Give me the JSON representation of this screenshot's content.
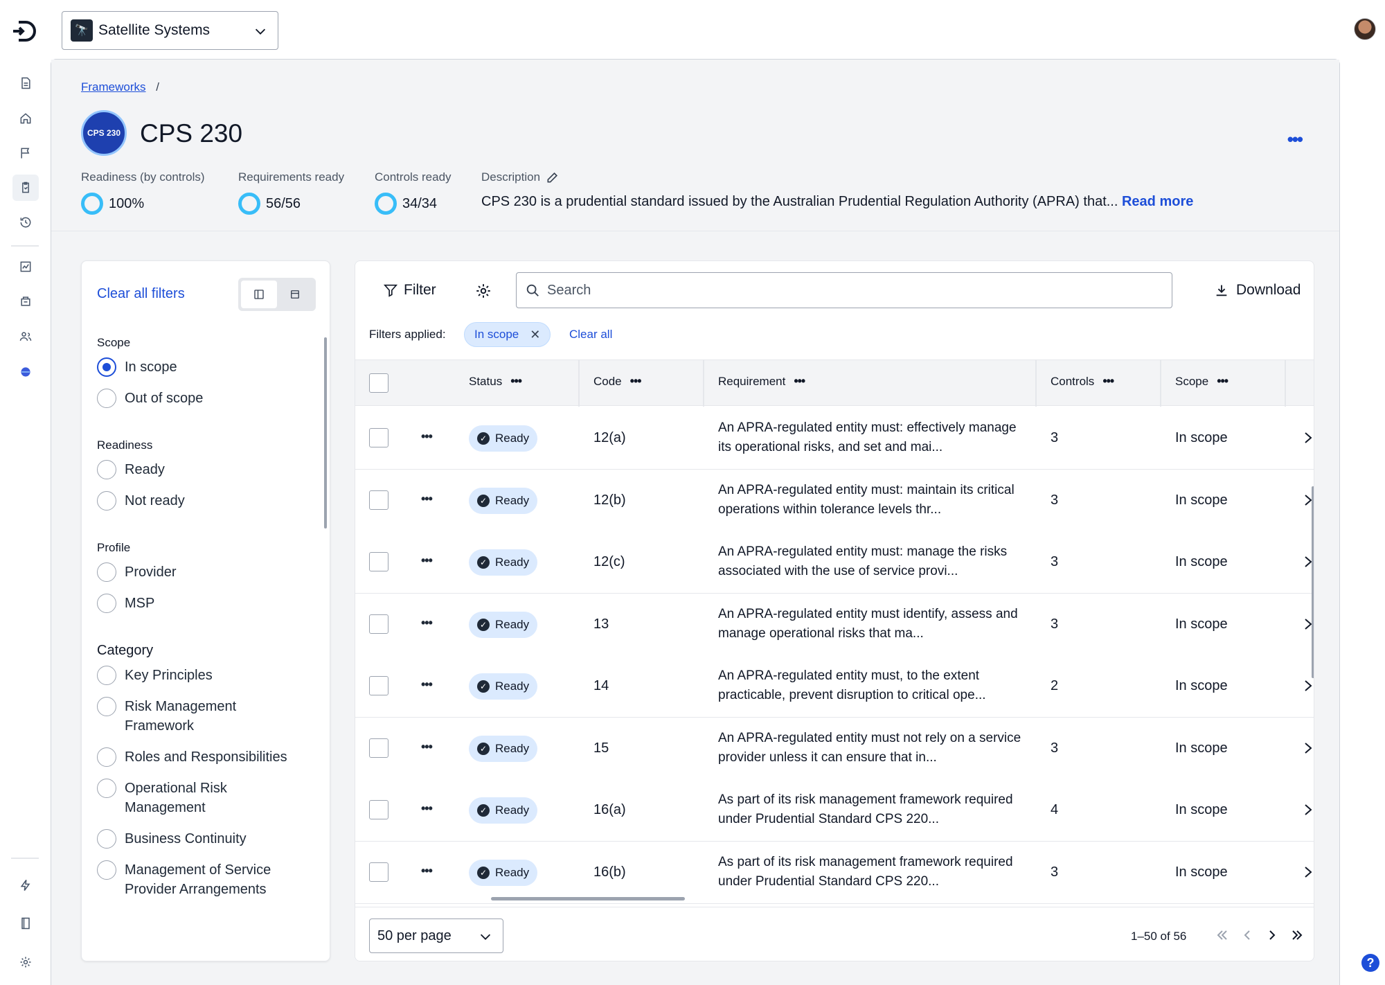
{
  "workspace": {
    "name": "Satellite Systems",
    "icon": "telescope-icon"
  },
  "breadcrumb": {
    "parent": "Frameworks",
    "separator": "/"
  },
  "framework": {
    "logo_text": "CPS 230",
    "title": "CPS 230",
    "stats": {
      "readiness_label": "Readiness (by controls)",
      "readiness_value": "100%",
      "requirements_label": "Requirements ready",
      "requirements_value": "56/56",
      "controls_label": "Controls ready",
      "controls_value": "34/34"
    },
    "description_label": "Description",
    "description": "CPS 230 is a prudential standard issued by the Australian Prudential Regulation Authority (APRA) that...",
    "read_more": "Read more"
  },
  "filters": {
    "clear_all": "Clear all filters",
    "groups": [
      {
        "title": "Scope",
        "options": [
          {
            "label": "In scope",
            "selected": true
          },
          {
            "label": "Out of scope",
            "selected": false
          }
        ]
      },
      {
        "title": "Readiness",
        "options": [
          {
            "label": "Ready",
            "selected": false
          },
          {
            "label": "Not ready",
            "selected": false
          }
        ]
      },
      {
        "title": "Profile",
        "options": [
          {
            "label": "Provider",
            "selected": false
          },
          {
            "label": "MSP",
            "selected": false
          }
        ]
      },
      {
        "title": "Category",
        "options": [
          {
            "label": "Key Principles",
            "selected": false
          },
          {
            "label": "Risk Management Framework",
            "selected": false
          },
          {
            "label": "Roles and Responsibilities",
            "selected": false
          },
          {
            "label": "Operational Risk Management",
            "selected": false
          },
          {
            "label": "Business Continuity",
            "selected": false
          },
          {
            "label": "Management of Service Provider Arrangements",
            "selected": false
          }
        ]
      }
    ]
  },
  "toolbar": {
    "filter_label": "Filter",
    "search_placeholder": "Search",
    "download_label": "Download",
    "filters_applied_label": "Filters applied:",
    "chip_label": "In scope",
    "clear_all": "Clear all"
  },
  "table": {
    "columns": [
      "Status",
      "Code",
      "Requirement",
      "Controls",
      "Scope"
    ],
    "rows": [
      {
        "status": "Ready",
        "code": "12(a)",
        "requirement": "An APRA-regulated entity must: effectively manage its operational risks, and set and mai...",
        "controls": "3",
        "scope": "In scope"
      },
      {
        "status": "Ready",
        "code": "12(b)",
        "requirement": "An APRA-regulated entity must: maintain its critical operations within tolerance levels thr...",
        "controls": "3",
        "scope": "In scope"
      },
      {
        "status": "Ready",
        "code": "12(c)",
        "requirement": "An APRA-regulated entity must: manage the risks associated with the use of service provi...",
        "controls": "3",
        "scope": "In scope"
      },
      {
        "status": "Ready",
        "code": "13",
        "requirement": "An APRA-regulated entity must identify, assess and manage operational risks that ma...",
        "controls": "3",
        "scope": "In scope"
      },
      {
        "status": "Ready",
        "code": "14",
        "requirement": "An APRA-regulated entity must, to the extent practicable, prevent disruption to critical ope...",
        "controls": "2",
        "scope": "In scope"
      },
      {
        "status": "Ready",
        "code": "15",
        "requirement": "An APRA-regulated entity must not rely on a service provider unless it can ensure that in...",
        "controls": "3",
        "scope": "In scope"
      },
      {
        "status": "Ready",
        "code": "16(a)",
        "requirement": "As part of its risk management framework required under Prudential Standard CPS 220...",
        "controls": "4",
        "scope": "In scope"
      },
      {
        "status": "Ready",
        "code": "16(b)",
        "requirement": "As part of its risk management framework required under Prudential Standard CPS 220...",
        "controls": "3",
        "scope": "In scope"
      }
    ]
  },
  "pagination": {
    "per_page": "50 per page",
    "info": "1–50 of 56"
  },
  "help": "?"
}
